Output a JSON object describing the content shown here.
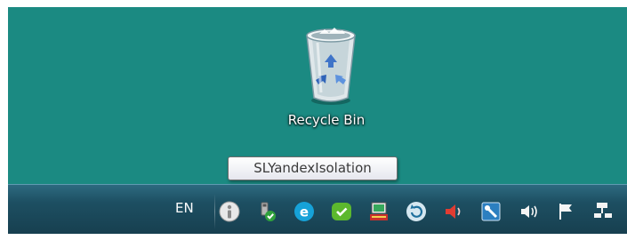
{
  "desktop": {
    "icons": [
      {
        "label": "Recycle Bin",
        "icon": "recycle-bin-icon"
      }
    ],
    "background_color": "#1b8a82"
  },
  "tooltip": {
    "text": "SLYandexIsolation"
  },
  "taskbar": {
    "language": "EN",
    "tray_icons": [
      "sl-yandex-isolation-icon",
      "safely-remove-hardware-icon",
      "yandex-browser-icon",
      "security-check-icon",
      "network-tool-icon",
      "sync-icon",
      "speaker-muted-icon",
      "remote-access-icon",
      "volume-icon",
      "action-center-flag-icon",
      "network-icon"
    ]
  }
}
